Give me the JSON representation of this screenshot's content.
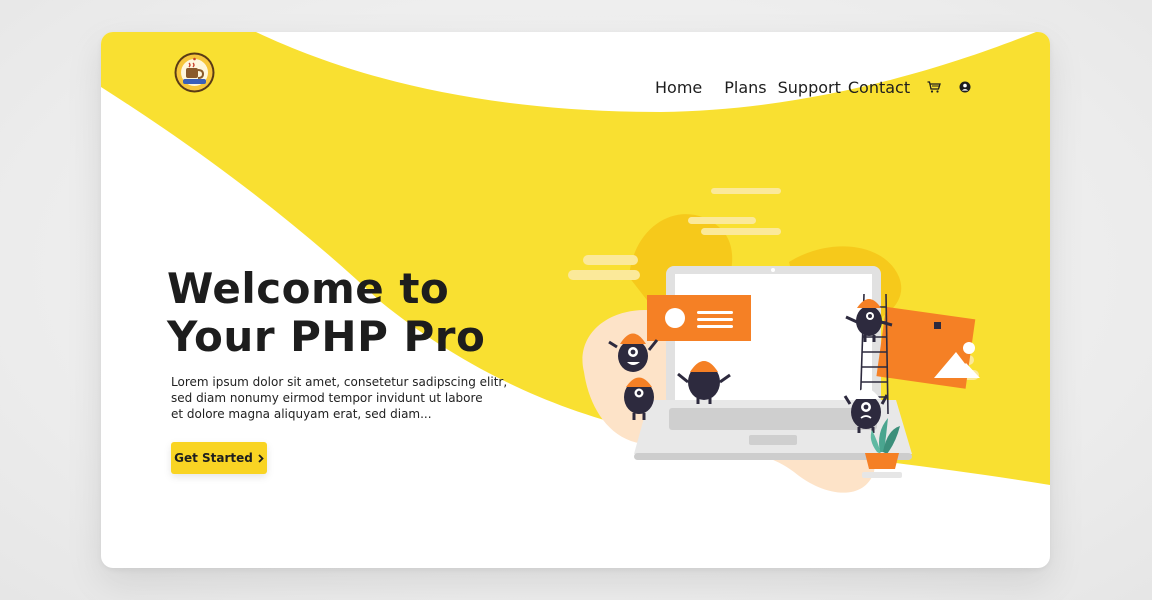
{
  "brand": {
    "logo_icon": "coffee-cup-badge-icon"
  },
  "nav": {
    "items": [
      {
        "label": "Home",
        "active": true
      },
      {
        "label": "Plans",
        "active": false
      },
      {
        "label": "Support",
        "active": false
      },
      {
        "label": "Contact",
        "active": false
      }
    ],
    "cart_icon": "cart-icon",
    "account_icon": "user-account-icon"
  },
  "hero": {
    "title_line1": "Welcome to",
    "title_line2": "Your PHP Pro",
    "text_lines": [
      "Lorem ipsum dolor sit amet, consetetur  sadipscing elitr,",
      "sed diam nonumy  eirmod tempor invidunt ut labore",
      "et dolore magna aliquyam erat, sed diam..."
    ],
    "cta_label": "Get Started",
    "cta_icon": "chevron-right-icon"
  },
  "colors": {
    "accent_yellow": "#f9e031",
    "accent_orange": "#f58025",
    "text_dark": "#1d1d1d",
    "monster_dark": "#2d2a3e"
  }
}
